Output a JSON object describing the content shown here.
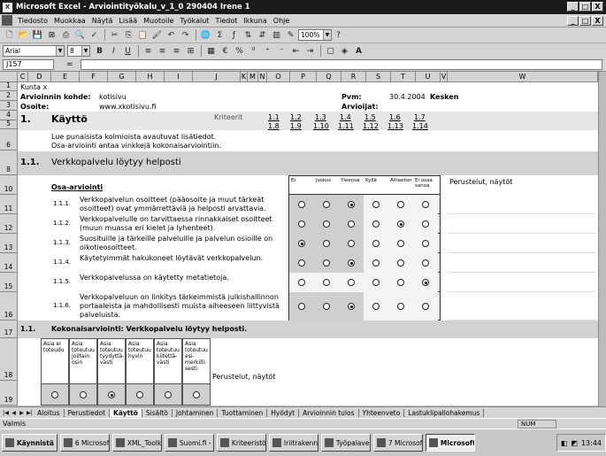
{
  "window": {
    "title": "Microsoft Excel - Arviointityökalu_v_1_0 290404 Irene 1",
    "app_icon": "X",
    "minimize": "_",
    "restore": "□",
    "close": "X"
  },
  "menu": [
    "Tiedosto",
    "Muokkaa",
    "Näytä",
    "Lisää",
    "Muotoile",
    "Työkalut",
    "Tiedot",
    "Ikkuna",
    "Ohje"
  ],
  "format_toolbar": {
    "font": "Arial",
    "size": "8",
    "zoom": "100%"
  },
  "formula_bar": {
    "name_box": "J157",
    "fx": "=",
    "value": ""
  },
  "columns": [
    "C",
    "D",
    "E",
    "F",
    "G",
    "H",
    "I",
    "J",
    "K",
    "M",
    "N",
    "O",
    "P",
    "Q",
    "R",
    "S",
    "T",
    "U",
    "V",
    "W"
  ],
  "rows": [
    "1",
    "2",
    "3",
    "4",
    "5",
    "6",
    "8",
    "10",
    "11",
    "12",
    "13",
    "14",
    "15",
    "16",
    "17",
    "18",
    "19",
    "20"
  ],
  "sheet": {
    "kunta": "Kunta x",
    "kohde_label": "Arvioinnin kohde:",
    "kohde_value": "kotisivu",
    "osoite_label": "Osoite:",
    "osoite_value": "www.xkotisivu.fi",
    "pvm_label": "Pvm:",
    "pvm_value": "30.4.2004",
    "kesken": "Kesken",
    "arvioijat_label": "Arvioijat:",
    "section_num": "1.",
    "section_title": "Käyttö",
    "kriteerit": "Kriteerit",
    "links_row1": [
      "1.1",
      "1.2",
      "1.3",
      "1.4",
      "1.5",
      "1.6",
      "1.7"
    ],
    "links_row2": [
      "1.8",
      "1.9",
      "1.10",
      "1.11",
      "1.12",
      "1.13",
      "1.14"
    ],
    "note1": "Lue punaisista kolmioista avautuvat lisätiedot.",
    "note2": "Osa-arviointi antaa vinkkejä kokonaisarviointiin.",
    "sub_num": "1.1.",
    "sub_title": "Verkkopalvelu löytyy helposti",
    "osa_arviointi": "Osa-arviointi",
    "option_headers": [
      "Ei",
      "Joskus",
      "Yleensä",
      "Kyllä",
      "Aiheeton",
      "Ei osaa sanoa"
    ],
    "perustelut": "Perustelut, näytöt",
    "items": [
      {
        "num": "1.1.1.",
        "text": "Verkkopalvelun osoitteet (pääosoite ja muut tärkeät osoitteet) ovat ymmärrettäviä ja helposti arvattavia.",
        "selected": 2
      },
      {
        "num": "1.1.2.",
        "text": "Verkkopalvelulle on tarvittaessa rinnakkaiset osoitteet (muun muassa eri kielet ja lyhenteet).",
        "selected": 4
      },
      {
        "num": "1.1.3.",
        "text": "Suosituille ja tärkeille palveluille ja palvelun osioille on oikotieosoitteet.",
        "selected": 0
      },
      {
        "num": "1.1.4.",
        "text": "Käytetyimmät hakukoneet löytävät verkkopalvelun.",
        "selected": 2
      },
      {
        "num": "1.1.5.",
        "text": "Verkkopalvelussa on käytetty metatietoja.",
        "selected": 5
      },
      {
        "num": "1.1.6.",
        "text": "Verkkopalveluun on linkitys tärkeimmistä julkishallinnon portaaleista ja mahdollisesti muista aiheeseen liittyvistä palveluista.",
        "selected": 2
      }
    ],
    "kokonais_num": "1.1.",
    "kokonais_title": "Kokonaisarviointi: Verkkopalvelu löytyy helposti.",
    "kokonais_options": [
      "Asia ei toteudu",
      "Asia toteutuu joiltain osin",
      "Asia toteutuu tyydyttä-västi",
      "Asia toteutuu hyvin",
      "Asia toteutuu kiitettä-västi",
      "Asia toteutuu esi-merkilli-sesti"
    ],
    "kokonais_selected": 2,
    "perustelut2": "Perustelut, näytöt"
  },
  "sheet_tabs": [
    "Aloitus",
    "Perustiedot",
    "Käyttö",
    "Sisältö",
    "Johtaminen",
    "Tuottaminen",
    "Hyödyt",
    "Arvioinnin tulos",
    "Yhteenveto",
    "Lastuklipallohakemus"
  ],
  "active_tab": "Käyttö",
  "status": {
    "text": "Valmis",
    "num": "NUM"
  },
  "taskbar": {
    "start": "Käynnistä",
    "buttons": [
      "6 Microsof...",
      "XML_Toolkit...",
      "Suomi.fi - su...",
      "Kriteeristön ...",
      "Iriitrakennej...",
      "Työpalaveri ...",
      "7 Microsof...",
      "Microsoft E..."
    ],
    "clock": "13:44"
  }
}
